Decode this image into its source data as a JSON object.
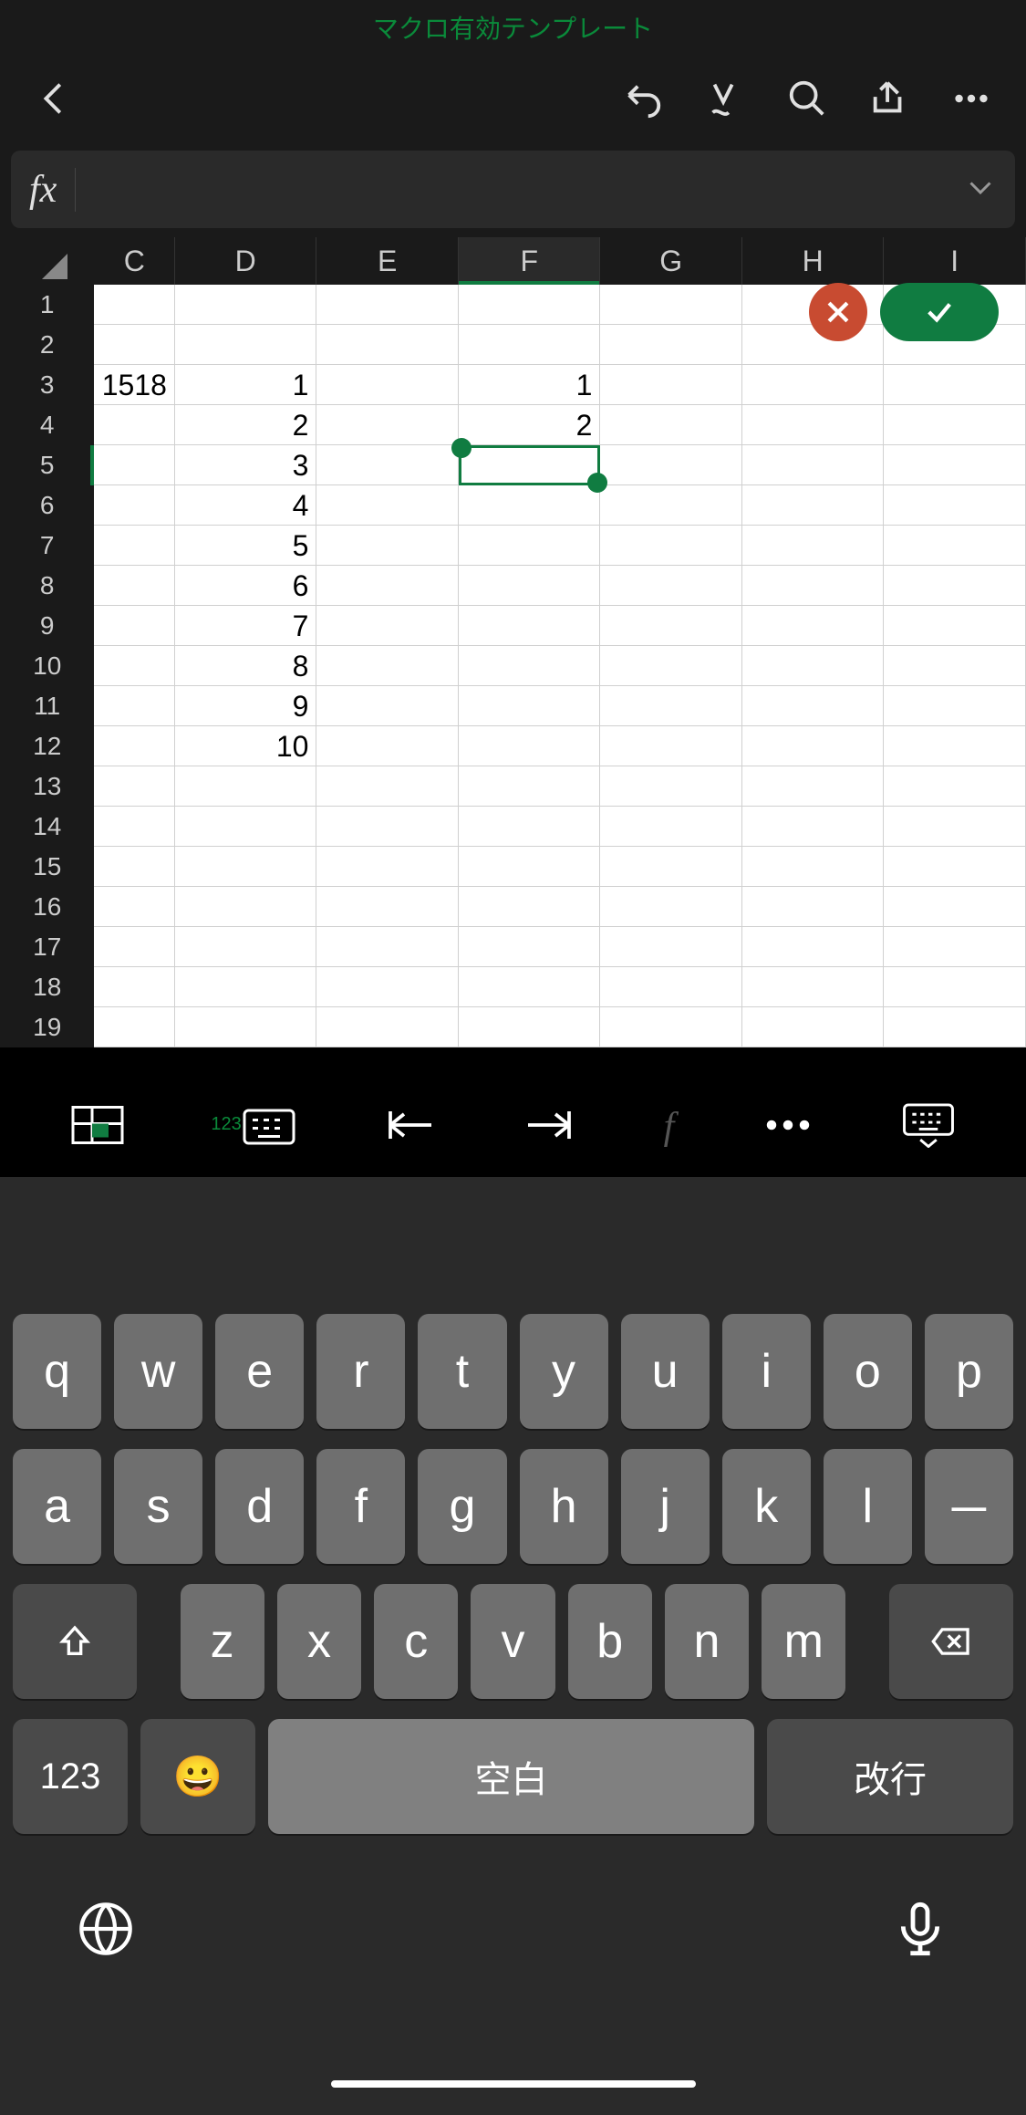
{
  "title": "マクロ有効テンプレート",
  "formula_bar": {
    "fx": "fx",
    "value": ""
  },
  "grid": {
    "columns": [
      "C",
      "D",
      "E",
      "F",
      "G",
      "H",
      "I"
    ],
    "active_column": "F",
    "active_row": 5,
    "selected_cell": "F5",
    "rows": {
      "3": {
        "C": "1518",
        "D": "1",
        "F": "1"
      },
      "4": {
        "D": "2",
        "F": "2"
      },
      "5": {
        "D": "3"
      },
      "6": {
        "D": "4"
      },
      "7": {
        "D": "5"
      },
      "8": {
        "D": "6"
      },
      "9": {
        "D": "7"
      },
      "10": {
        "D": "8"
      },
      "11": {
        "D": "9"
      },
      "12": {
        "D": "10"
      }
    },
    "row_count": 19
  },
  "bottom_bar": {
    "num_badge": "123"
  },
  "keyboard": {
    "row1": [
      "q",
      "w",
      "e",
      "r",
      "t",
      "y",
      "u",
      "i",
      "o",
      "p"
    ],
    "row2": [
      "a",
      "s",
      "d",
      "f",
      "g",
      "h",
      "j",
      "k",
      "l",
      "－"
    ],
    "row3": [
      "z",
      "x",
      "c",
      "v",
      "b",
      "n",
      "m"
    ],
    "num_key": "123",
    "space_label": "空白",
    "enter_label": "改行"
  }
}
